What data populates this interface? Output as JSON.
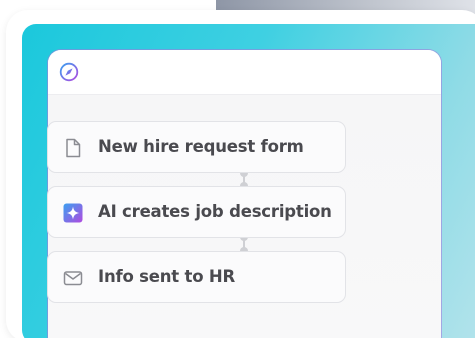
{
  "workflow": {
    "steps": [
      {
        "label": "New hire request form",
        "icon": "document-icon"
      },
      {
        "label": "AI creates job description",
        "icon": "ai-sparkle-icon"
      },
      {
        "label": "Info sent to HR",
        "icon": "mail-icon"
      }
    ]
  },
  "colors": {
    "panel_accent": "#1bc8dc",
    "ai_gradient_start": "#3aa0f0",
    "ai_gradient_end": "#b04be0",
    "text": "#4a4a4f"
  }
}
